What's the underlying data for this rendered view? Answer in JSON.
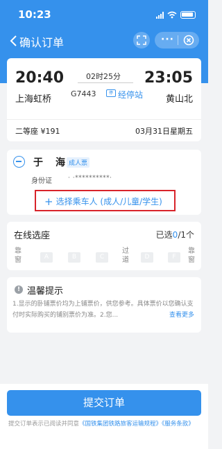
{
  "status_bar": {
    "time": "10:23"
  },
  "navbar": {
    "title": "确认订单",
    "menu_dots": "···"
  },
  "trip": {
    "departure_time": "20:40",
    "departure_station": "上海虹桥",
    "arrival_time": "23:05",
    "arrival_station": "黄山北",
    "duration": "02时25分",
    "train_number": "G7443",
    "stops_icon_text": "停",
    "stops_label": "经停站",
    "seat_price": "二等座 ¥191",
    "date": "03月31日星期五"
  },
  "passenger": {
    "name": "于　海",
    "ticket_type": "成人票",
    "id_label": "身份证",
    "id_number": "·  ·**********·"
  },
  "add_passenger": {
    "label": "选择乘车人 (成人/儿童/学生)"
  },
  "seat_selection": {
    "title": "在线选座",
    "count_prefix": "已选",
    "selected": "0",
    "count_suffix": "/1个",
    "window_left": "靠窗",
    "aisle": "过道",
    "window_right": "靠窗",
    "seats": [
      "A",
      "B",
      "C",
      "D",
      "F"
    ]
  },
  "tips": {
    "title": "温馨提示",
    "text": "1.显示的卧铺票价均为上铺票价，供您参考。具体票价以您确认支付时实际购买的铺别票价为准。2.您...",
    "more": "查看更多"
  },
  "footer": {
    "submit_label": "提交订单",
    "agreement_prefix": "提交订单表示已阅读并同意",
    "rule_link": "《国铁集团铁路旅客运输规程》",
    "service_link": "《服务条款》"
  },
  "colors": {
    "primary": "#3591ec",
    "highlight_box": "#d8232a"
  }
}
